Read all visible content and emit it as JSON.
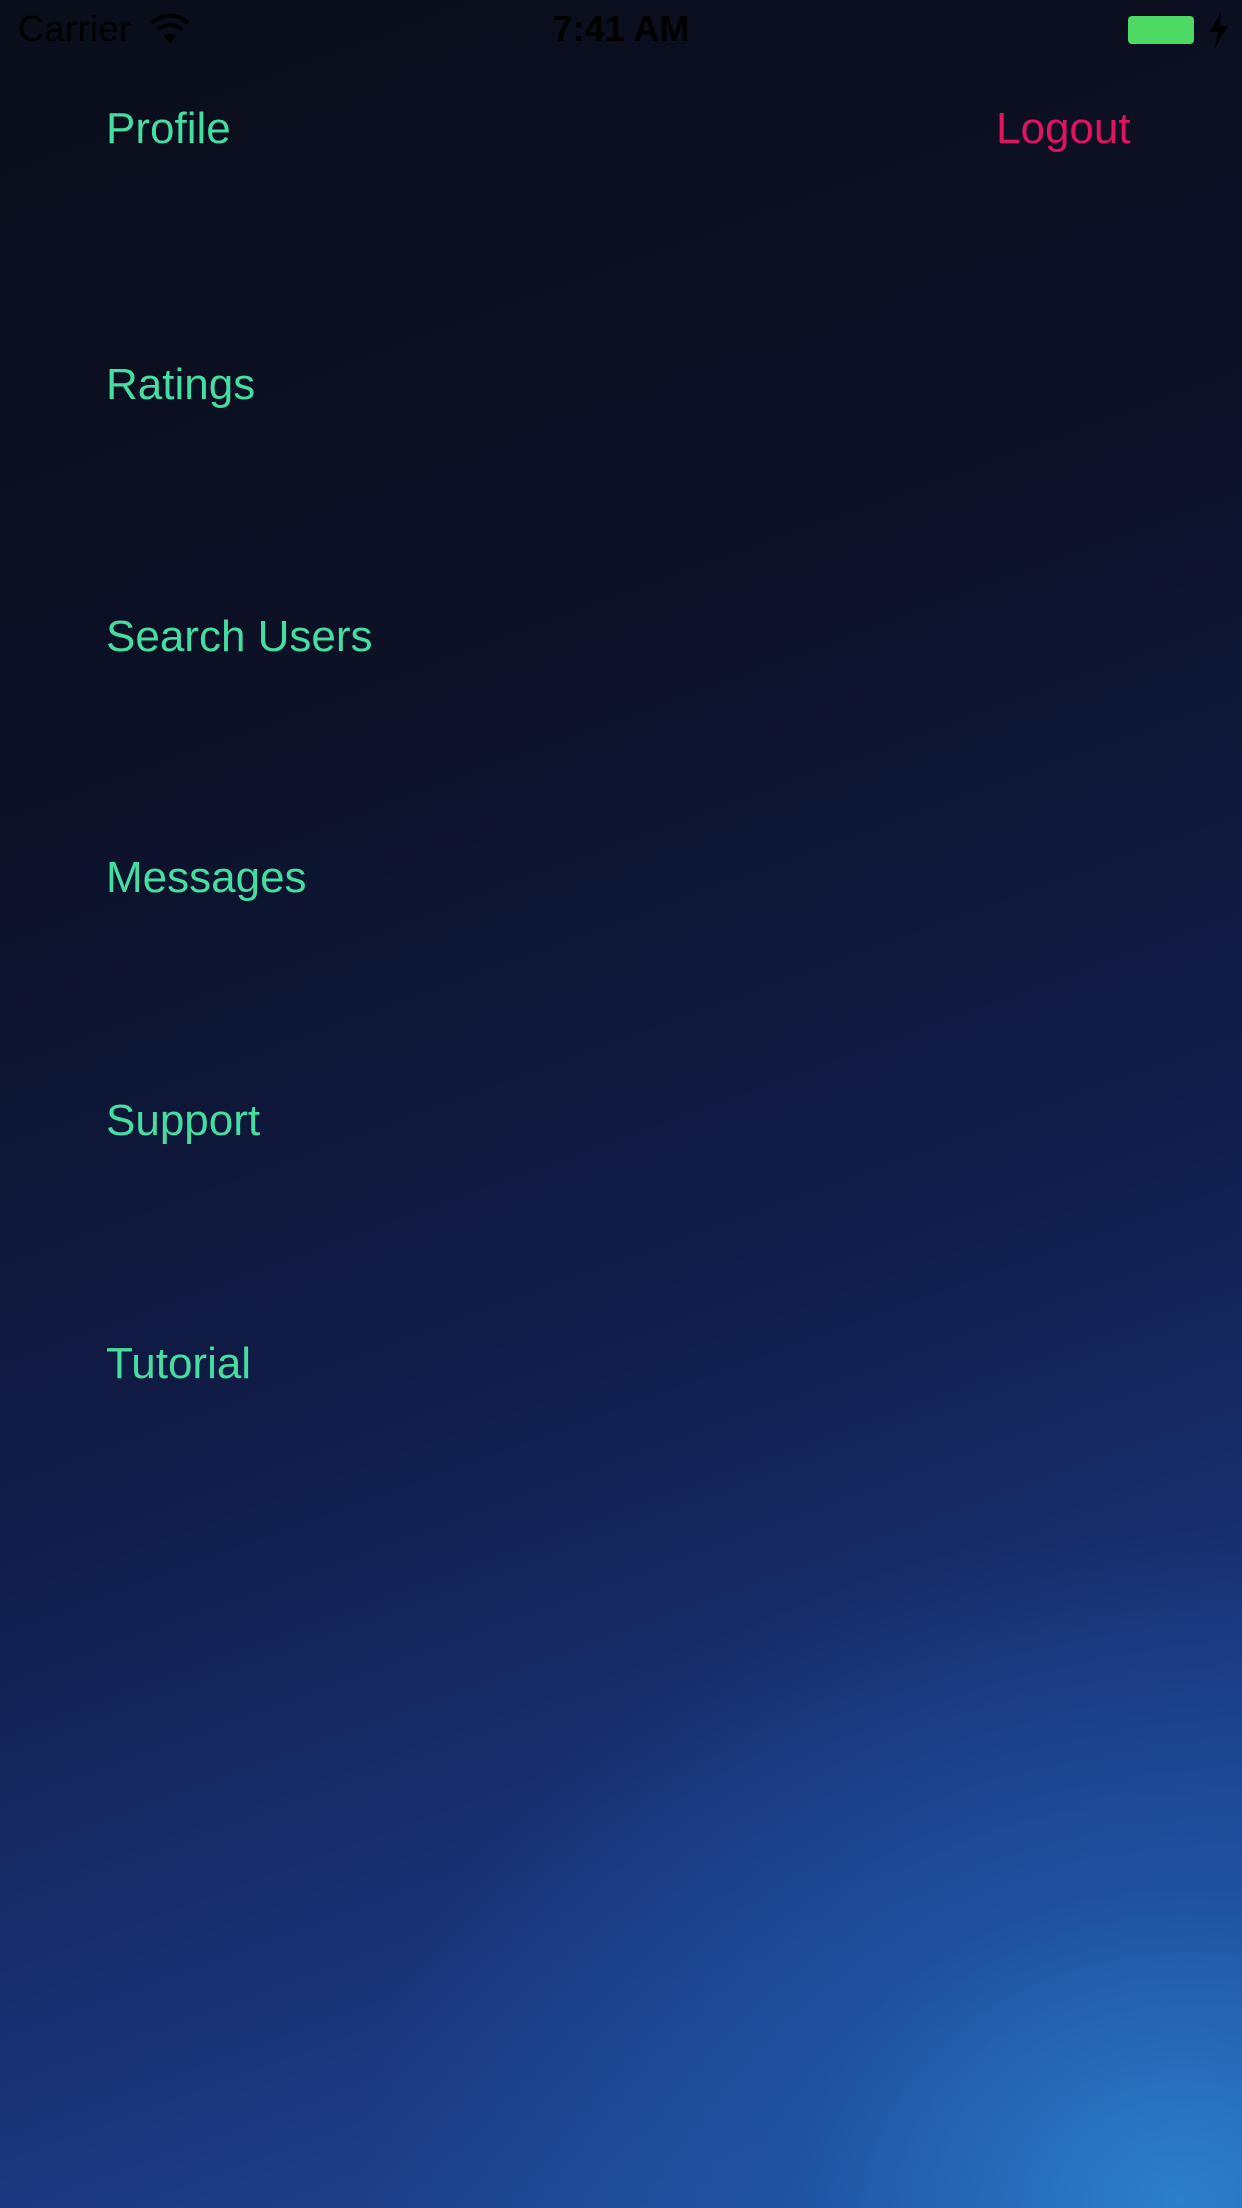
{
  "status_bar": {
    "carrier": "Carrier",
    "time": "7:41 AM",
    "wifi_icon": "wifi-icon",
    "battery_icon": "battery-icon",
    "battery_color": "#4cd964"
  },
  "header": {
    "profile_label": "Profile",
    "logout_label": "Logout"
  },
  "menu": {
    "items": [
      {
        "label": "Ratings"
      },
      {
        "label": "Search Users"
      },
      {
        "label": "Messages"
      },
      {
        "label": "Support"
      },
      {
        "label": "Tutorial"
      }
    ]
  },
  "colors": {
    "link": "#46dda0",
    "logout": "#e0135f",
    "background_top": "#0a0d1a",
    "background_bottom": "#2a7cc4"
  }
}
